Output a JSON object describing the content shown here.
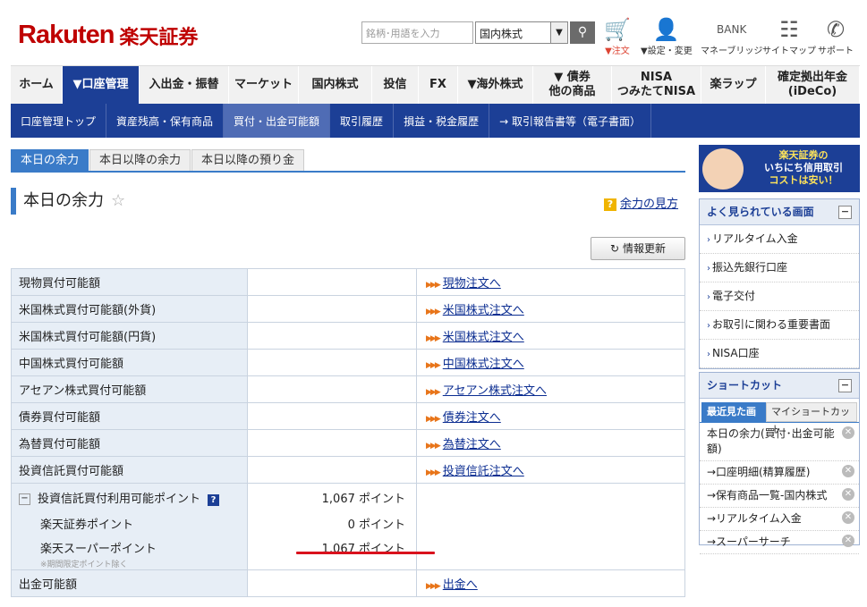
{
  "header": {
    "logo_rakuten": "Rakuten",
    "logo_kanji": "楽天証券",
    "search_placeholder": "銘柄･用語を入力",
    "search_select": "国内株式",
    "icons": [
      {
        "label": "▼注文",
        "icon": "cart-icon"
      },
      {
        "label": "▼設定・変更",
        "icon": "person-icon"
      },
      {
        "label": "マネーブリッジ",
        "icon": "bank-icon"
      },
      {
        "label": "サイトマップ",
        "icon": "sitemap-icon"
      },
      {
        "label": "サポート",
        "icon": "phone-icon"
      }
    ],
    "bank_small": "BANK"
  },
  "mainnav": [
    {
      "label": "ホーム",
      "w": 58
    },
    {
      "label": "▼口座管理",
      "w": 86,
      "active": true
    },
    {
      "label": "入出金・振替",
      "w": 100
    },
    {
      "label": "マーケット",
      "w": 78
    },
    {
      "label": "国内株式",
      "w": 82
    },
    {
      "label": "投信",
      "w": 52
    },
    {
      "label": "FX",
      "w": 44
    },
    {
      "label": "▼海外株式",
      "w": 84
    },
    {
      "label": "▼ 債券\n他の商品",
      "w": 88
    },
    {
      "label": "NISA\nつみたてNISA",
      "w": 100
    },
    {
      "label": "楽ラップ",
      "w": 72
    },
    {
      "label": "確定拠出年金\n(iDeCo)",
      "w": 105
    }
  ],
  "subnav": [
    {
      "label": "口座管理トップ"
    },
    {
      "label": "資産残高・保有商品"
    },
    {
      "label": "買付・出金可能額",
      "active": true
    },
    {
      "label": "取引履歴"
    },
    {
      "label": "損益・税金履歴"
    },
    {
      "label": "→ 取引報告書等（電子書面）"
    }
  ],
  "tabs": [
    "本日の余力",
    "本日以降の余力",
    "本日以降の預り金"
  ],
  "page": {
    "title": "本日の余力",
    "howto": "余力の見方",
    "refresh": "情報更新"
  },
  "rows": [
    {
      "label": "現物買付可能額",
      "value": "",
      "link": "現物注文へ"
    },
    {
      "label": "米国株式買付可能額(外貨)",
      "value": "",
      "link": "米国株式注文へ"
    },
    {
      "label": "米国株式買付可能額(円貨)",
      "value": "",
      "link": "米国株式注文へ"
    },
    {
      "label": "中国株式買付可能額",
      "value": "",
      "link": "中国株式注文へ"
    },
    {
      "label": "アセアン株式買付可能額",
      "value": "",
      "link": "アセアン株式注文へ"
    },
    {
      "label": "債券買付可能額",
      "value": "",
      "link": "債券注文へ"
    },
    {
      "label": "為替買付可能額",
      "value": "",
      "link": "為替注文へ"
    },
    {
      "label": "投資信託買付可能額",
      "value": "",
      "link": "投資信託注文へ"
    }
  ],
  "points": {
    "label": "投資信託買付利用可能ポイント",
    "value": "1,067 ポイント",
    "sub1_label": "楽天証券ポイント",
    "sub1_value": "0 ポイント",
    "sub2_label": "楽天スーパーポイント",
    "sub2_value": "1,067 ポイント",
    "note": "※期間限定ポイント除く"
  },
  "withdraw": {
    "label": "出金可能額",
    "link": "出金へ"
  },
  "sidebar": {
    "banner_line1": "楽天証券の",
    "banner_line2": "いちにち信用取引",
    "banner_line3": "コストは安い！",
    "popular_title": "よく見られている画面",
    "popular": [
      "リアルタイム入金",
      "振込先銀行口座",
      "電子交付",
      "お取引に関わる重要書面",
      "NISA口座"
    ],
    "shortcut_title": "ショートカット",
    "shortcut_tabs": [
      "最近見た画面",
      "マイショートカット"
    ],
    "shortcuts": [
      "本日の余力(買付･出金可能額)",
      "→口座明細(精算履歴)",
      "→保有商品一覧-国内株式",
      "→リアルタイム入金",
      "→スーパーサーチ"
    ]
  }
}
